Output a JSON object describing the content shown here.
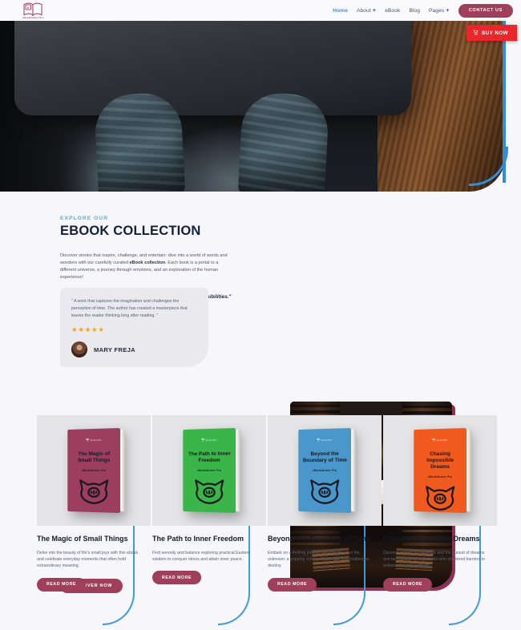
{
  "brand": {
    "name": "eBookAuthor Pro",
    "logo_letter": "e",
    "logo_icon": "open-book-icon"
  },
  "nav": {
    "items": [
      {
        "label": "Home",
        "active": true,
        "has_dropdown": false
      },
      {
        "label": "About",
        "active": false,
        "has_dropdown": true
      },
      {
        "label": "eBook",
        "active": false,
        "has_dropdown": false
      },
      {
        "label": "Blog",
        "active": false,
        "has_dropdown": false
      },
      {
        "label": "Pages",
        "active": false,
        "has_dropdown": true
      }
    ],
    "contact_label": "CONTACT US"
  },
  "hero": {
    "buy_label": "BUY NOW",
    "cart_icon": "shopping-cart-icon",
    "image_alt": "person at desk with laptop seen from above"
  },
  "collection": {
    "eyebrow": "EXPLORE OUR",
    "heading": "EBOOK COLLECTION",
    "paragraph_pre": "Discover stories that inspire, challenge, and entertain: dive into a world of words and wonders with our carefully curated ",
    "paragraph_bold": "eBook collection",
    "paragraph_post": ". Each book is a portal to a different universe, a journey through emotions, and an exploration of the human experience!",
    "pullquote": "\"Imagination is the key that unlocks the door to endless possibilities.\"",
    "discover_label": "DISCOVER NOW",
    "image_alt": "dark bookstore aisle with floating open book",
    "testimonial": {
      "quote": "” A work that captures the imagination and challenges the perception of time. The author has created a masterpiece that leaves the reader thinking long after reading. ”",
      "stars": 5,
      "star_glyph": "★",
      "name": "MARY FREJA",
      "avatar_alt": "portrait of Mary Freja"
    }
  },
  "books": [
    {
      "cover_title": "The Magic of Small Things",
      "cover_sub": "eBookAuthor Pro",
      "cover_brand": "Example",
      "color": "#9c3f5e",
      "title": "The Magic of Small Things",
      "desc": "Delve into the beauty of life's small joys with this ebook and celebrate everyday moments that often hold extraordinary meaning.",
      "read_label": "READ MORE"
    },
    {
      "cover_title": "The Path to Inner Freedom",
      "cover_sub": "eBookAuthor Pro",
      "cover_brand": "Example",
      "color": "#39b54a",
      "title": "The Path to Inner Freedom",
      "desc": "Find serenity and balance exploring practical Eastern wisdom to conquer stress and attain inner peace.",
      "read_label": "READ MORE"
    },
    {
      "cover_title": "Beyond the Boundary of Time",
      "cover_sub": "eBookAuthor Pro",
      "cover_brand": "Example",
      "color": "#4a97cc",
      "title": "Beyond the Boundary of Time",
      "desc": "Embark on a thrilling journey through time and the unknown: a gripping science fiction tale that challenges destiny.",
      "read_label": "READ MORE"
    },
    {
      "cover_title": "Chasing Impossible Dreams",
      "cover_sub": "eBookAuthor Pro",
      "cover_brand": "Example",
      "color": "#f05a1e",
      "title": "Chasing Impossible Dreams",
      "desc": "Discover stories of resilience and the pursuit of dreams and be inspired by individuals who shattered barriers to achieve the extraordinary.",
      "read_label": "READ MORE"
    }
  ],
  "colors": {
    "accent_blue": "#3e9bd8",
    "accent_maroon": "#9e3f5c",
    "buy_red": "#e8262b",
    "eyebrow_blue": "#5aa7e3",
    "heading_navy": "#12203a",
    "star_gold": "#f0a32e",
    "page_bg": "#f7f7fb"
  }
}
